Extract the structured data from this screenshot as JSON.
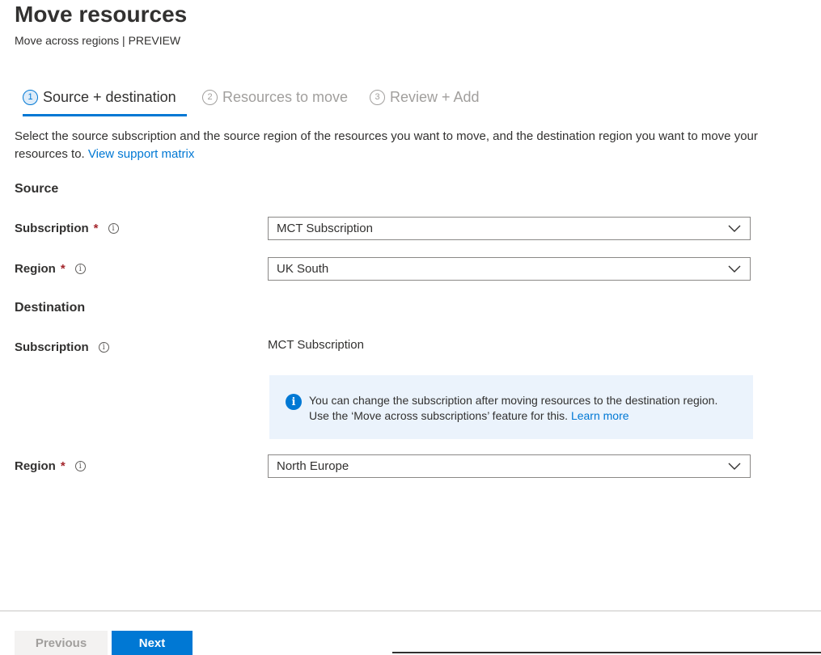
{
  "header": {
    "title": "Move resources",
    "subtitle": "Move across regions | PREVIEW"
  },
  "steps": [
    {
      "number": "1",
      "label": "Source + destination",
      "active": true
    },
    {
      "number": "2",
      "label": "Resources to move",
      "active": false
    },
    {
      "number": "3",
      "label": "Review + Add",
      "active": false
    }
  ],
  "description": {
    "text": "Select the source subscription and the source region of the resources you want to move, and the destination region you want to move your resources to.",
    "link": "View support matrix"
  },
  "source": {
    "heading": "Source",
    "subscription_label": "Subscription",
    "subscription_value": "MCT Subscription",
    "region_label": "Region",
    "region_value": "UK South"
  },
  "destination": {
    "heading": "Destination",
    "subscription_label": "Subscription",
    "subscription_value": "MCT Subscription",
    "info_text": "You can change the subscription after moving resources to the destination region. Use the ‘Move across subscriptions’ feature for this.",
    "info_link": "Learn more",
    "region_label": "Region",
    "region_value": "North Europe"
  },
  "required_marker": "*",
  "info_glyph": "i",
  "footer": {
    "previous_label": "Previous",
    "next_label": "Next"
  },
  "colors": {
    "accent": "#0078d4",
    "required": "#a4262c",
    "info_bg": "#ebf3fc"
  }
}
